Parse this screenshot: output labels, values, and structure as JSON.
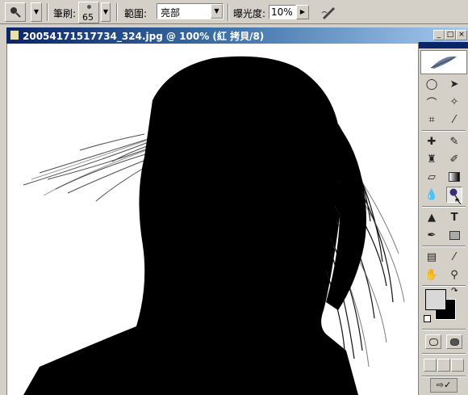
{
  "options_bar": {
    "brush_label": "筆刷:",
    "brush_size": "65",
    "range_label": "範圍:",
    "range_value": "亮部",
    "exposure_label": "曝光度:",
    "exposure_value": "10%"
  },
  "document": {
    "title": "20054171517734_324.jpg @ 100% (紅 拷貝/8)"
  },
  "toolbox": {
    "tools": [
      "marquee-tool",
      "move-tool",
      "lasso-tool",
      "magic-wand-tool",
      "crop-tool",
      "slice-tool",
      "healing-brush-tool",
      "brush-tool",
      "clone-stamp-tool",
      "history-brush-tool",
      "eraser-tool",
      "gradient-tool",
      "blur-tool",
      "dodge-tool",
      "path-selection-tool",
      "type-tool",
      "pen-tool",
      "shape-tool",
      "notes-tool",
      "eyedropper-tool",
      "hand-tool",
      "zoom-tool"
    ],
    "colors": {
      "foreground": "#d8d8d8",
      "background": "#000000"
    }
  }
}
